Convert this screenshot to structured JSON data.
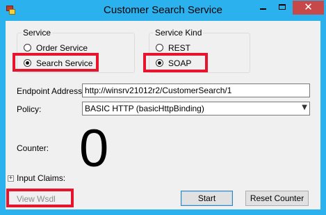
{
  "window": {
    "title": "Customer Search Service"
  },
  "service_group": {
    "label": "Service",
    "options": [
      {
        "label": "Order Service",
        "checked": false
      },
      {
        "label": "Search Service",
        "checked": true
      }
    ]
  },
  "service_kind_group": {
    "label": "Service Kind",
    "options": [
      {
        "label": "REST",
        "checked": false
      },
      {
        "label": "SOAP",
        "checked": true
      }
    ]
  },
  "endpoint": {
    "label": "Endpoint Address:",
    "value": "http://winsrv21012r2/CustomerSearch/1"
  },
  "policy": {
    "label": "Policy:",
    "selected": "BASIC HTTP (basicHttpBinding)"
  },
  "counter": {
    "label": "Counter:",
    "value": "0"
  },
  "input_claims": {
    "label": "Input Claims:"
  },
  "buttons": {
    "view_wsdl": "View Wsdl",
    "start": "Start",
    "reset_counter": "Reset Counter"
  },
  "colors": {
    "title_bar": "#2bb1ee",
    "highlight": "#e8132d",
    "close_button": "#c74848"
  }
}
